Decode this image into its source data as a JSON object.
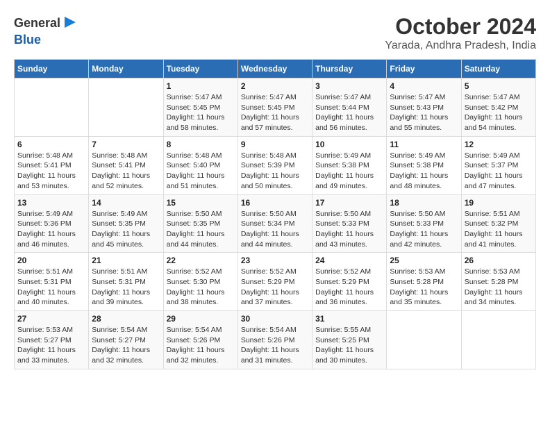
{
  "logo": {
    "line1": "General",
    "line2": "Blue"
  },
  "title": "October 2024",
  "subtitle": "Yarada, Andhra Pradesh, India",
  "days_of_week": [
    "Sunday",
    "Monday",
    "Tuesday",
    "Wednesday",
    "Thursday",
    "Friday",
    "Saturday"
  ],
  "weeks": [
    [
      {
        "day": "",
        "info": ""
      },
      {
        "day": "",
        "info": ""
      },
      {
        "day": "1",
        "info": "Sunrise: 5:47 AM\nSunset: 5:45 PM\nDaylight: 11 hours and 58 minutes."
      },
      {
        "day": "2",
        "info": "Sunrise: 5:47 AM\nSunset: 5:45 PM\nDaylight: 11 hours and 57 minutes."
      },
      {
        "day": "3",
        "info": "Sunrise: 5:47 AM\nSunset: 5:44 PM\nDaylight: 11 hours and 56 minutes."
      },
      {
        "day": "4",
        "info": "Sunrise: 5:47 AM\nSunset: 5:43 PM\nDaylight: 11 hours and 55 minutes."
      },
      {
        "day": "5",
        "info": "Sunrise: 5:47 AM\nSunset: 5:42 PM\nDaylight: 11 hours and 54 minutes."
      }
    ],
    [
      {
        "day": "6",
        "info": "Sunrise: 5:48 AM\nSunset: 5:41 PM\nDaylight: 11 hours and 53 minutes."
      },
      {
        "day": "7",
        "info": "Sunrise: 5:48 AM\nSunset: 5:41 PM\nDaylight: 11 hours and 52 minutes."
      },
      {
        "day": "8",
        "info": "Sunrise: 5:48 AM\nSunset: 5:40 PM\nDaylight: 11 hours and 51 minutes."
      },
      {
        "day": "9",
        "info": "Sunrise: 5:48 AM\nSunset: 5:39 PM\nDaylight: 11 hours and 50 minutes."
      },
      {
        "day": "10",
        "info": "Sunrise: 5:49 AM\nSunset: 5:38 PM\nDaylight: 11 hours and 49 minutes."
      },
      {
        "day": "11",
        "info": "Sunrise: 5:49 AM\nSunset: 5:38 PM\nDaylight: 11 hours and 48 minutes."
      },
      {
        "day": "12",
        "info": "Sunrise: 5:49 AM\nSunset: 5:37 PM\nDaylight: 11 hours and 47 minutes."
      }
    ],
    [
      {
        "day": "13",
        "info": "Sunrise: 5:49 AM\nSunset: 5:36 PM\nDaylight: 11 hours and 46 minutes."
      },
      {
        "day": "14",
        "info": "Sunrise: 5:49 AM\nSunset: 5:35 PM\nDaylight: 11 hours and 45 minutes."
      },
      {
        "day": "15",
        "info": "Sunrise: 5:50 AM\nSunset: 5:35 PM\nDaylight: 11 hours and 44 minutes."
      },
      {
        "day": "16",
        "info": "Sunrise: 5:50 AM\nSunset: 5:34 PM\nDaylight: 11 hours and 44 minutes."
      },
      {
        "day": "17",
        "info": "Sunrise: 5:50 AM\nSunset: 5:33 PM\nDaylight: 11 hours and 43 minutes."
      },
      {
        "day": "18",
        "info": "Sunrise: 5:50 AM\nSunset: 5:33 PM\nDaylight: 11 hours and 42 minutes."
      },
      {
        "day": "19",
        "info": "Sunrise: 5:51 AM\nSunset: 5:32 PM\nDaylight: 11 hours and 41 minutes."
      }
    ],
    [
      {
        "day": "20",
        "info": "Sunrise: 5:51 AM\nSunset: 5:31 PM\nDaylight: 11 hours and 40 minutes."
      },
      {
        "day": "21",
        "info": "Sunrise: 5:51 AM\nSunset: 5:31 PM\nDaylight: 11 hours and 39 minutes."
      },
      {
        "day": "22",
        "info": "Sunrise: 5:52 AM\nSunset: 5:30 PM\nDaylight: 11 hours and 38 minutes."
      },
      {
        "day": "23",
        "info": "Sunrise: 5:52 AM\nSunset: 5:29 PM\nDaylight: 11 hours and 37 minutes."
      },
      {
        "day": "24",
        "info": "Sunrise: 5:52 AM\nSunset: 5:29 PM\nDaylight: 11 hours and 36 minutes."
      },
      {
        "day": "25",
        "info": "Sunrise: 5:53 AM\nSunset: 5:28 PM\nDaylight: 11 hours and 35 minutes."
      },
      {
        "day": "26",
        "info": "Sunrise: 5:53 AM\nSunset: 5:28 PM\nDaylight: 11 hours and 34 minutes."
      }
    ],
    [
      {
        "day": "27",
        "info": "Sunrise: 5:53 AM\nSunset: 5:27 PM\nDaylight: 11 hours and 33 minutes."
      },
      {
        "day": "28",
        "info": "Sunrise: 5:54 AM\nSunset: 5:27 PM\nDaylight: 11 hours and 32 minutes."
      },
      {
        "day": "29",
        "info": "Sunrise: 5:54 AM\nSunset: 5:26 PM\nDaylight: 11 hours and 32 minutes."
      },
      {
        "day": "30",
        "info": "Sunrise: 5:54 AM\nSunset: 5:26 PM\nDaylight: 11 hours and 31 minutes."
      },
      {
        "day": "31",
        "info": "Sunrise: 5:55 AM\nSunset: 5:25 PM\nDaylight: 11 hours and 30 minutes."
      },
      {
        "day": "",
        "info": ""
      },
      {
        "day": "",
        "info": ""
      }
    ]
  ]
}
